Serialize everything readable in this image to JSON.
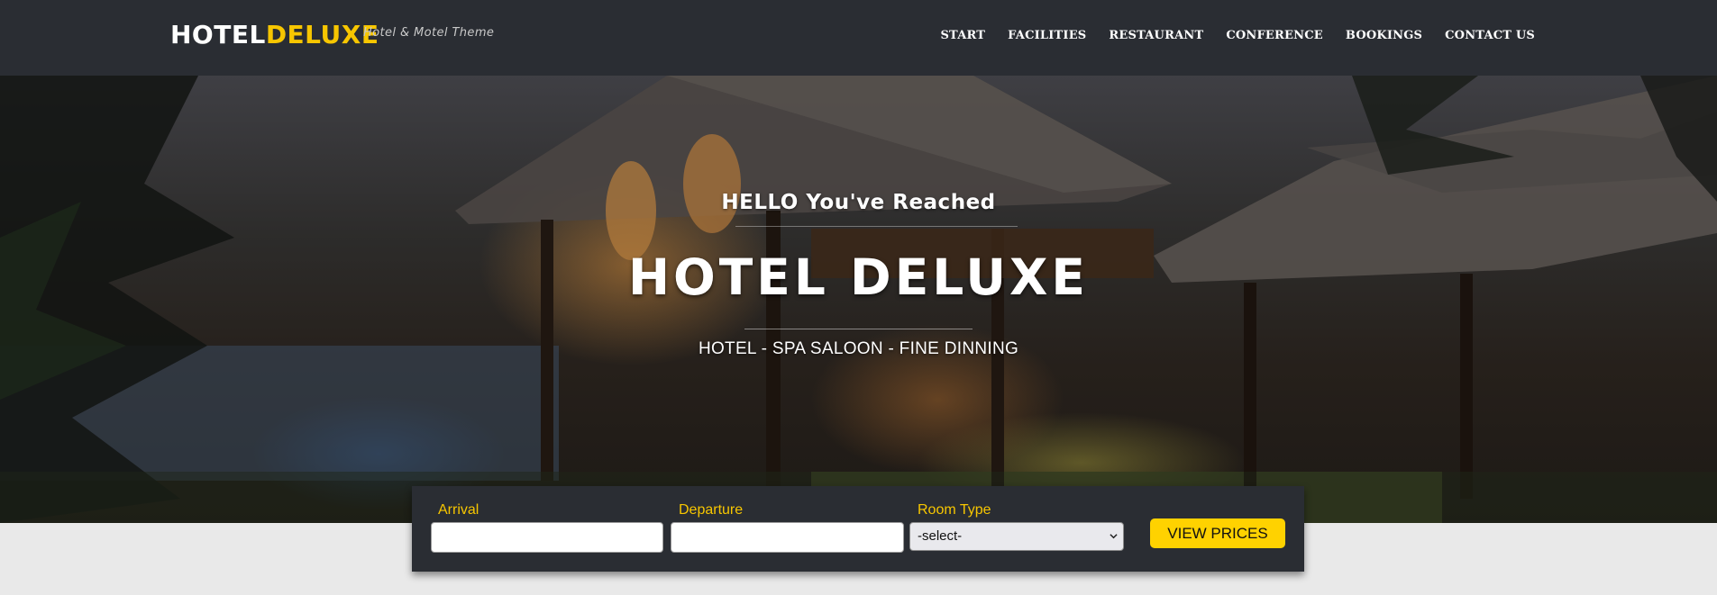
{
  "brand": {
    "logo_part1": "HOTEL",
    "logo_part2": "DELUXE",
    "tagline": "Hotel & Motel Theme"
  },
  "nav": {
    "items": [
      {
        "label": "START"
      },
      {
        "label": "FACILITIES"
      },
      {
        "label": "RESTAURANT"
      },
      {
        "label": "CONFERENCE"
      },
      {
        "label": "BOOKINGS"
      },
      {
        "label": "CONTACT US"
      }
    ]
  },
  "hero": {
    "hello": "HELLO You've Reached",
    "title": "HOTEL DELUXE",
    "subtitle": "HOTEL - SPA SALOON - FINE DINNING"
  },
  "booking": {
    "arrival_label": "Arrival",
    "arrival_value": "",
    "departure_label": "Departure",
    "departure_value": "",
    "room_type_label": "Room Type",
    "room_type_selected": "-select-",
    "submit_label": "VIEW PRICES"
  },
  "colors": {
    "header_bg": "#2a2d33",
    "accent_yellow": "#f7c600",
    "button_yellow": "#ffd200"
  }
}
